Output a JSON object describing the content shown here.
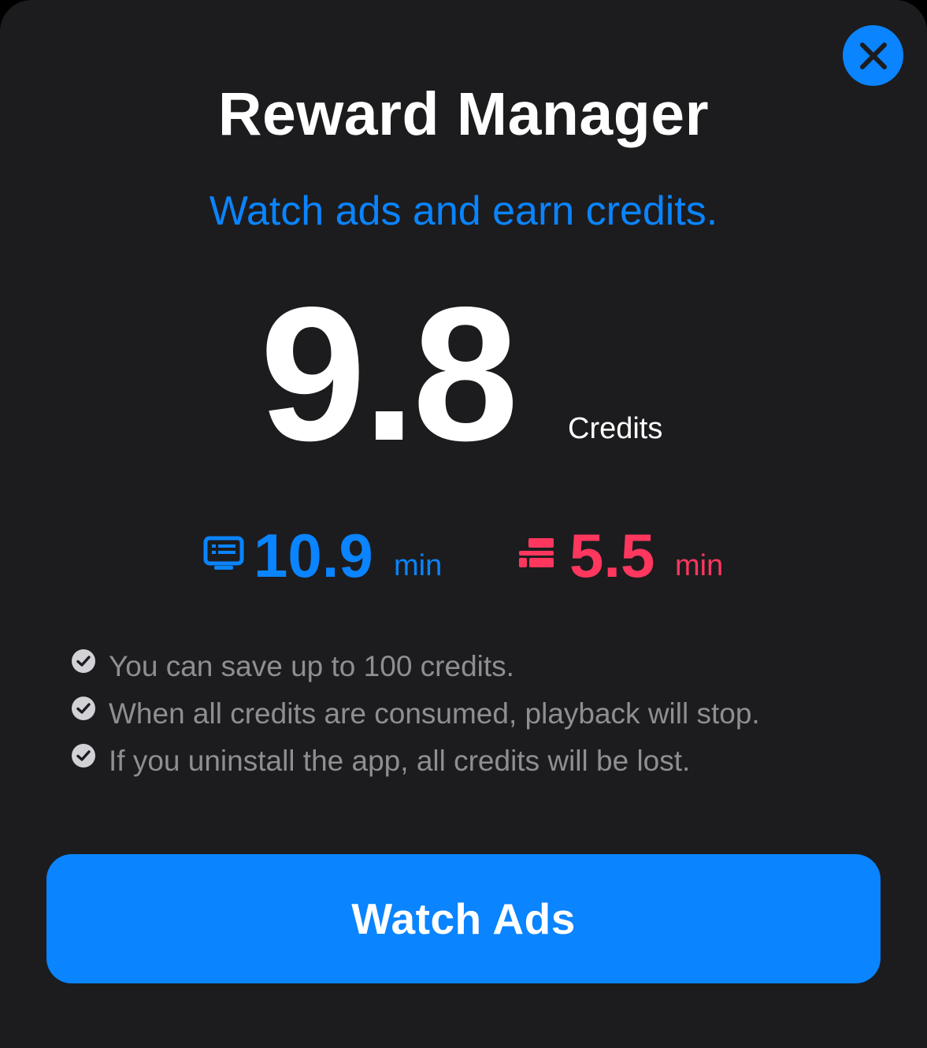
{
  "dialog": {
    "title": "Reward Manager",
    "subtitle": "Watch ads and earn credits.",
    "close_icon": "close-icon"
  },
  "balance": {
    "value": "9.8",
    "unit": "Credits"
  },
  "stats": [
    {
      "icon": "tv-icon",
      "value": "10.9",
      "unit": "min",
      "color": "#0a84ff"
    },
    {
      "icon": "ticket-icon",
      "value": "5.5",
      "unit": "min",
      "color": "#ff375f"
    }
  ],
  "notes": [
    {
      "icon": "checkmark-circle-icon",
      "text": "You can save up to 100 credits."
    },
    {
      "icon": "checkmark-circle-icon",
      "text": "When all credits are consumed, playback will stop."
    },
    {
      "icon": "checkmark-circle-icon",
      "text": "If you uninstall the app, all credits will be lost."
    }
  ],
  "primary_action": {
    "label": "Watch Ads"
  },
  "colors": {
    "background": "#1c1c1e",
    "accent": "#0a84ff",
    "alert": "#ff375f",
    "secondary_text": "#8e8e93"
  }
}
